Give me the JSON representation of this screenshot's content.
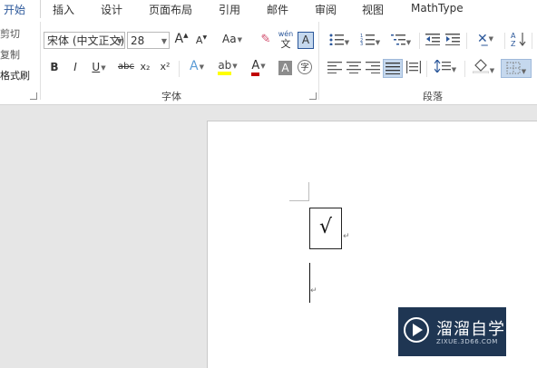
{
  "tabs": [
    {
      "label": "开始",
      "active": true
    },
    {
      "label": "插入"
    },
    {
      "label": "设计"
    },
    {
      "label": "页面布局"
    },
    {
      "label": "引用"
    },
    {
      "label": "邮件"
    },
    {
      "label": "审阅"
    },
    {
      "label": "视图"
    },
    {
      "label": "MathType"
    }
  ],
  "clipboard": {
    "cut_label": "剪切",
    "copy_label": "复制",
    "format_painter_label": "格式刷"
  },
  "font": {
    "name_value": "宋体 (中文正文)",
    "size_value": "28",
    "group_label": "字体",
    "change_case_label": "Aa",
    "phonetic_top": "wén",
    "phonetic_bottom": "文",
    "border_label": "A",
    "bold_label": "B",
    "italic_label": "I",
    "underline_label": "U",
    "strike_label": "abc",
    "subscript_label": "x₂",
    "superscript_label": "x²",
    "text_effect_label": "A",
    "font_color_label": "A",
    "char_shade_label": "A",
    "enclose_label": "字"
  },
  "paragraph": {
    "group_label": "段落"
  },
  "document": {
    "check_symbol": "√",
    "paragraph_mark": "↵"
  },
  "watermark": {
    "brand": "溜溜自学",
    "url": "ZIXUE.3D66.COM"
  },
  "colors": {
    "accent": "#2b579a",
    "highlight": "#ffff00",
    "font_color": "#c00000",
    "watermark_bg": "#1f3653"
  }
}
